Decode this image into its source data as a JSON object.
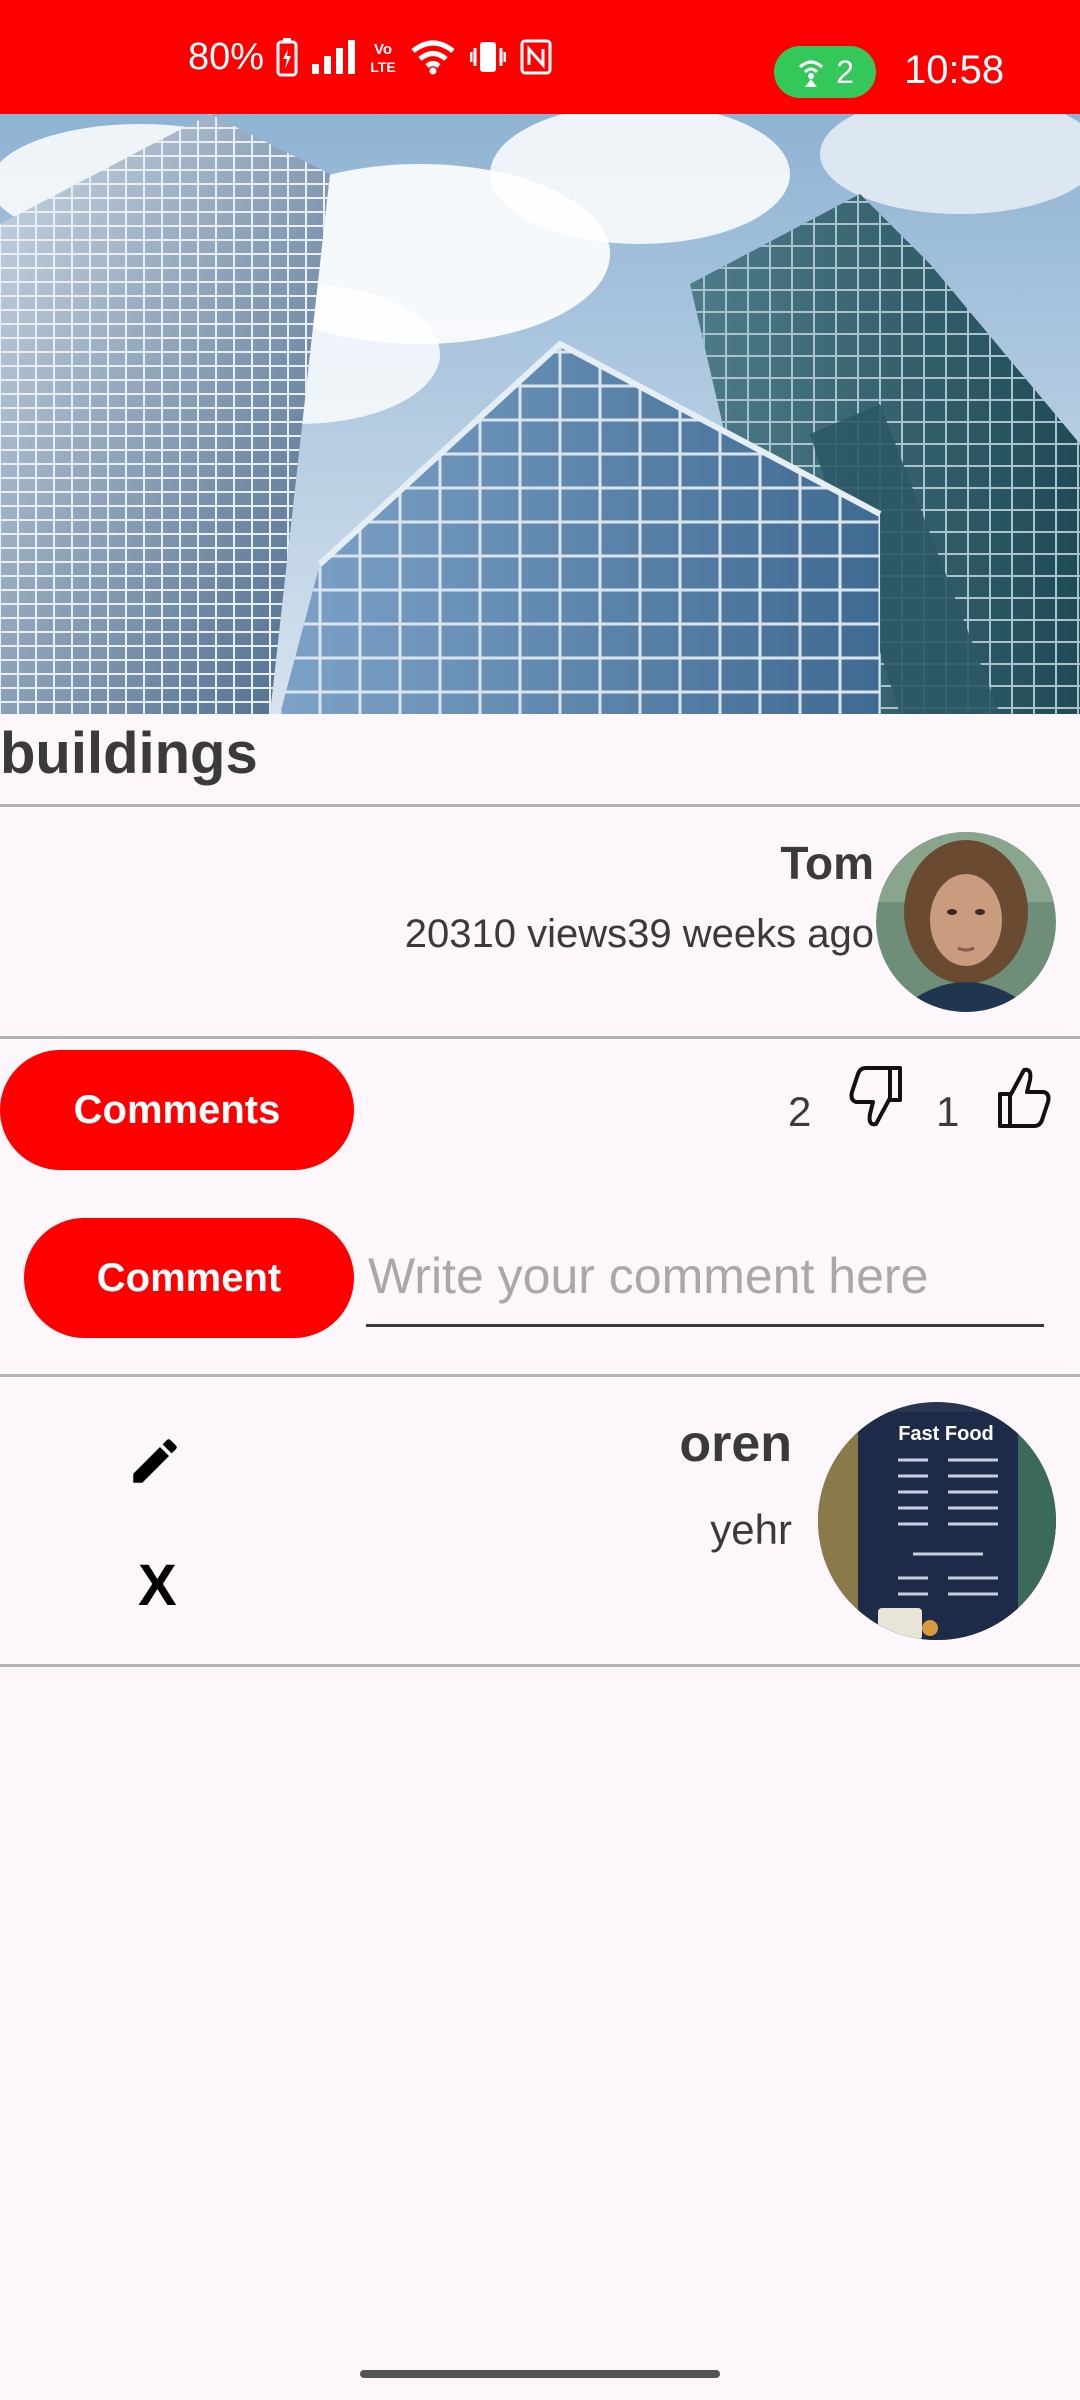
{
  "status_bar": {
    "battery": "80%",
    "hotspot_count": "2",
    "time": "10:58",
    "background_color": "#ff0000"
  },
  "video": {
    "title": "buildings",
    "author": "Tom",
    "meta": "20310 views39 weeks ago"
  },
  "actions": {
    "comments_button": "Comments",
    "dislike_count": "2",
    "like_count": "1",
    "accent_color": "#ff0000"
  },
  "comment_form": {
    "button_label": "Comment",
    "placeholder": "Write your comment here"
  },
  "comments": [
    {
      "user": "oren",
      "text": "yehr",
      "delete_label": "X",
      "avatar_caption": "Fast Food"
    }
  ],
  "icons": {
    "edit": "pencil-icon",
    "dislike": "thumbs-down-icon",
    "like": "thumbs-up-icon"
  }
}
